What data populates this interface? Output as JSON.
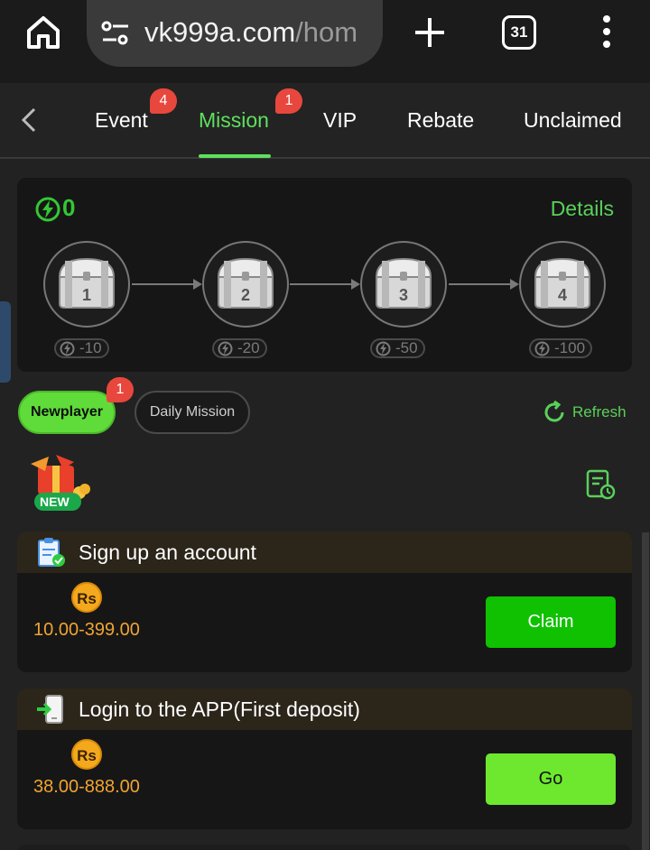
{
  "browser": {
    "url_host": "vk999a.com",
    "url_path": "/hom",
    "tab_count": "31",
    "icons": [
      "home-icon",
      "site-settings-icon",
      "new-tab-icon",
      "tab-switcher-icon",
      "more-menu-icon"
    ]
  },
  "nav": {
    "tabs": [
      {
        "label": "Event",
        "badge": "4"
      },
      {
        "label": "Mission",
        "badge": "1"
      },
      {
        "label": "VIP"
      },
      {
        "label": "Rebate"
      },
      {
        "label": "Unclaimed"
      }
    ],
    "active_tab": "Mission"
  },
  "energy": {
    "count": "0",
    "details_label": "Details",
    "chests": [
      {
        "number": "1",
        "cost": "-10"
      },
      {
        "number": "2",
        "cost": "-20"
      },
      {
        "number": "3",
        "cost": "-50"
      },
      {
        "number": "4",
        "cost": "-100"
      }
    ]
  },
  "mission_types": {
    "newplayer_label": "Newplayer",
    "newplayer_badge": "1",
    "daily_label": "Daily Mission",
    "refresh_label": "Refresh",
    "new_badge_text": "NEW"
  },
  "missions": [
    {
      "title": "Sign up an account",
      "currency": "Rs",
      "reward": "10.00-399.00",
      "action": "Claim"
    },
    {
      "title": "Login to the APP(First deposit)",
      "currency": "Rs",
      "reward": "38.00-888.00",
      "action": "Go"
    }
  ],
  "colors": {
    "accent_green": "#5ee05e",
    "claim_green": "#0fc100",
    "go_green": "#6de82e",
    "reward_orange": "#f0a432",
    "badge_red": "#e8473d"
  }
}
